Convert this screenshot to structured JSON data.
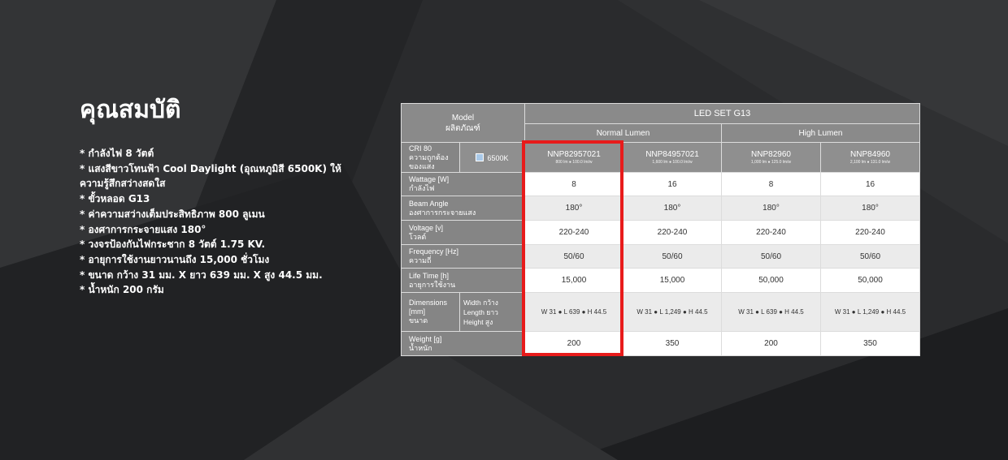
{
  "features": {
    "title": "คุณสมบัติ",
    "items": [
      "* กำลังไฟ 8 วัตต์",
      "* แสงสีขาวโทนฟ้า Cool Daylight (อุณหภูมิสี 6500K) ให้ความรู้สึกสว่างสดใส",
      "* ขั้วหลอด G13",
      "* ค่าความสว่างเต็มประสิทธิภาพ 800 ลูเมน",
      "* องศาการกระจายแสง 180°",
      "* วงจรป้องกันไฟกระชาก 8 วัตต์ 1.75 KV.",
      "* อายุการใช้งานยาวนานถึง 15,000 ชั่วโมง",
      "* ขนาด กว้าง 31 มม. X ยาว 639 มม. X สูง 44.5 มม.",
      "* น้ำหนัก 200 กรัม"
    ]
  },
  "spec_table": {
    "model_label_en": "Model",
    "model_label_th": "ผลิตภัณฑ์",
    "product_header": "LED SET G13",
    "groups": [
      "Normal Lumen",
      "High Lumen"
    ],
    "cri_label_en": "CRI 80",
    "cri_label_th": "ความถูกต้อง ของแสง",
    "color_temp": "6500K",
    "skus": [
      {
        "code": "NNP82957021",
        "sub": "800 lm ● 100.0 lm/w"
      },
      {
        "code": "NNP84957021",
        "sub": "1,600 lm ● 100.0 lm/w"
      },
      {
        "code": "NNP82960",
        "sub": "1,000 lm ● 125.0 lm/w"
      },
      {
        "code": "NNP84960",
        "sub": "2,100 lm ● 131.0 lm/w"
      }
    ],
    "rows": [
      {
        "en": "Wattage [W]",
        "th": "กำลังไฟ",
        "values": [
          "8",
          "16",
          "8",
          "16"
        ]
      },
      {
        "en": "Beam Angle",
        "th": "องศาการกระจายแสง",
        "values": [
          "180°",
          "180°",
          "180°",
          "180°"
        ]
      },
      {
        "en": "Voltage [v]",
        "th": "โวลต์",
        "values": [
          "220-240",
          "220-240",
          "220-240",
          "220-240"
        ]
      },
      {
        "en": "Frequency [Hz]",
        "th": "ความถี่",
        "values": [
          "50/60",
          "50/60",
          "50/60",
          "50/60"
        ]
      },
      {
        "en": "Life Time [h]",
        "th": "อายุการใช้งาน",
        "values": [
          "15,000",
          "15,000",
          "50,000",
          "50,000"
        ]
      }
    ],
    "dimensions": {
      "en": "Dimensions [mm]",
      "th": "ขนาด",
      "sub_width": "Width กว้าง",
      "sub_length": "Length ยาว",
      "sub_height": "Height สูง",
      "values": [
        "W 31 ● L 639 ● H 44.5",
        "W 31 ● L 1,249 ● H 44.5",
        "W 31 ● L 639 ● H 44.5",
        "W 31 ● L 1,249 ● H 44.5"
      ]
    },
    "weight": {
      "en": "Weight [g]",
      "th": "น้ำหนัก",
      "values": [
        "200",
        "350",
        "200",
        "350"
      ]
    },
    "highlight_color": "#e81b1b"
  }
}
